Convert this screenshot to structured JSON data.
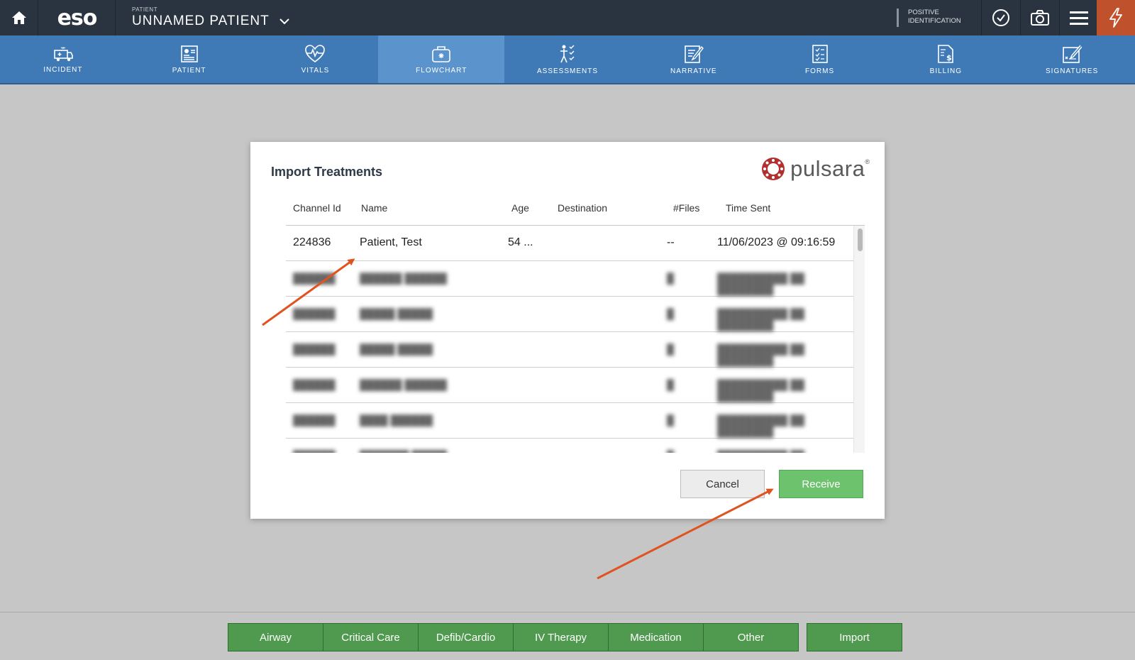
{
  "topbar": {
    "logo": "eso",
    "patient_caption": "PATIENT",
    "patient_name": "UNNAMED PATIENT",
    "positive_id_line1": "POSITIVE",
    "positive_id_line2": "IDENTIFICATION",
    "icons": [
      "home-icon",
      "chevron-down-icon",
      "check-circle-icon",
      "camera-icon",
      "menu-icon",
      "lightning-icon"
    ]
  },
  "nav": {
    "items": [
      {
        "label": "INCIDENT",
        "icon": "ambulance-icon"
      },
      {
        "label": "PATIENT",
        "icon": "patient-card-icon"
      },
      {
        "label": "VITALS",
        "icon": "heart-pulse-icon"
      },
      {
        "label": "FLOWCHART",
        "icon": "medical-bag-icon",
        "active": true
      },
      {
        "label": "ASSESSMENTS",
        "icon": "body-check-icon"
      },
      {
        "label": "NARRATIVE",
        "icon": "narrative-edit-icon"
      },
      {
        "label": "FORMS",
        "icon": "checklist-icon"
      },
      {
        "label": "BILLING",
        "icon": "billing-doc-icon"
      },
      {
        "label": "SIGNATURES",
        "icon": "signature-icon"
      }
    ]
  },
  "modal": {
    "title": "Import Treatments",
    "brand": "pulsara",
    "brand_reg": "®",
    "columns": [
      "Channel Id",
      "Name",
      "Age",
      "Destination",
      "#Files",
      "Time Sent"
    ],
    "rows": [
      {
        "channel": "224836",
        "name": "Patient, Test",
        "age": "54 ...",
        "destination": "",
        "files": "--",
        "time": "11/06/2023 @ 09:16:59",
        "blurred": false
      },
      {
        "channel": "",
        "name": "",
        "age": "",
        "destination": "",
        "files": "",
        "time": "",
        "blurred": true
      },
      {
        "channel": "",
        "name": "",
        "age": "",
        "destination": "",
        "files": "",
        "time": "",
        "blurred": true
      },
      {
        "channel": "",
        "name": "",
        "age": "",
        "destination": "",
        "files": "",
        "time": "",
        "blurred": true
      },
      {
        "channel": "",
        "name": "",
        "age": "",
        "destination": "",
        "files": "",
        "time": "",
        "blurred": true
      },
      {
        "channel": "",
        "name": "",
        "age": "",
        "destination": "",
        "files": "",
        "time": "",
        "blurred": true
      },
      {
        "channel": "",
        "name": "",
        "age": "",
        "destination": "",
        "files": "",
        "time": "",
        "blurred": true
      }
    ],
    "cancel_label": "Cancel",
    "receive_label": "Receive"
  },
  "colors": {
    "topbar": "#2a3440",
    "nav": "#3f7ab6",
    "nav_active": "#5b93cc",
    "receive": "#6dc26d",
    "toolbar_button": "#4f9a4f",
    "alert": "#c0512d",
    "annotation_arrow": "#e0531f"
  },
  "toolbar": {
    "buttons": [
      "Airway",
      "Critical Care",
      "Defib/Cardio",
      "IV Therapy",
      "Medication",
      "Other"
    ],
    "import_label": "Import"
  }
}
